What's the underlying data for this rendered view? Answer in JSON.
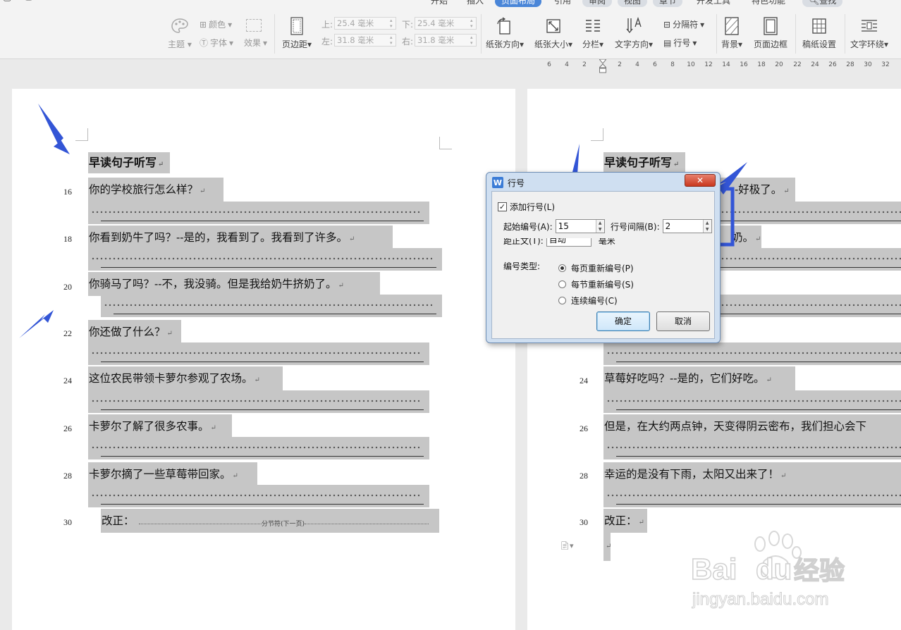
{
  "ribbon": {
    "tabs": {
      "start": "开始",
      "insert": "插入",
      "layout": "页面布局",
      "reference": "引用",
      "review": "审阅",
      "view": "视图",
      "section": "章节",
      "dev": "开发工具",
      "special": "特色功能",
      "search": "查找"
    },
    "theme_label": "主题",
    "color_label": "颜色",
    "font_label": "字体",
    "effect_label": "效果",
    "margins_label": "页边距",
    "top_label": "上:",
    "bottom_label": "下:",
    "left_label": "左:",
    "right_label": "右:",
    "top_value": "25.4 毫米",
    "bottom_value": "25.4 毫米",
    "left_value": "31.8 毫米",
    "right_value": "31.8 毫米",
    "orientation_label": "纸张方向",
    "size_label": "纸张大小",
    "columns_label": "分栏",
    "text_dir_label": "文字方向",
    "breaks_label": "分隔符",
    "line_num_label": "行号",
    "background_label": "背景",
    "page_border_label": "页面边框",
    "grid_paper_label": "稿纸设置",
    "wrap_label": "文字环绕"
  },
  "ruler": {
    "ticks": [
      "6",
      "4",
      "2",
      "2",
      "4",
      "6",
      "8",
      "10",
      "12",
      "14",
      "16",
      "18",
      "20",
      "22",
      "24",
      "26",
      "28",
      "30",
      "32"
    ]
  },
  "left_page": {
    "title": "早读句子听写",
    "lines": [
      {
        "num": "16",
        "text": "你的学校旅行怎么样？"
      },
      {
        "num": "18",
        "text": "你看到奶牛了吗？--是的，我看到了。我看到了许多。"
      },
      {
        "num": "20",
        "text": "你骑马了吗？--不，我没骑。但是我给奶牛挤奶了。"
      },
      {
        "num": "22",
        "text": "你还做了什么？"
      },
      {
        "num": "24",
        "text": "这位农民带领卡萝尔参观了农场。"
      },
      {
        "num": "26",
        "text": "卡萝尔了解了很多农事。"
      },
      {
        "num": "28",
        "text": "卡萝尔摘了一些草莓带回家。"
      },
      {
        "num": "30",
        "text": "改正："
      }
    ],
    "section_break": "分节符(下一页)"
  },
  "right_page": {
    "title": "早读句子听写",
    "lines": [
      {
        "num": "",
        "text": "-好极了。"
      },
      {
        "num": "",
        "text": "奶。"
      },
      {
        "num": "24",
        "text": "草莓好吃吗？--是的，它们好吃。"
      },
      {
        "num": "26",
        "text": "但是，在大约两点钟，天变得阴云密布，我们担心会下"
      },
      {
        "num": "28",
        "text": "幸运的是没有下雨，太阳又出来了！"
      },
      {
        "num": "30",
        "text": "改正："
      }
    ]
  },
  "dialog": {
    "title": "行号",
    "logo": "W",
    "close": "✕",
    "add_line_numbers": "添加行号(L)",
    "add_checked": true,
    "start_label": "起始编号(A):",
    "start_value": "15",
    "interval_label": "行号间隔(B):",
    "interval_value": "2",
    "distance_label": "距正文(T):",
    "distance_value": "自动",
    "distance_unit": "毫米",
    "type_label": "编号类型:",
    "options": [
      "每页重新编号(P)",
      "每节重新编号(S)",
      "连续编号(C)"
    ],
    "selected_option": 0,
    "ok": "确定",
    "cancel": "取消"
  },
  "watermark": {
    "brand": "Bai",
    "brand2": "du",
    "cn": "经验",
    "url": "jingyan.baidu.com"
  },
  "colors": {
    "accent": "#4a86d8",
    "annotation": "#3355d6",
    "highlight": "#c6c6c6"
  }
}
